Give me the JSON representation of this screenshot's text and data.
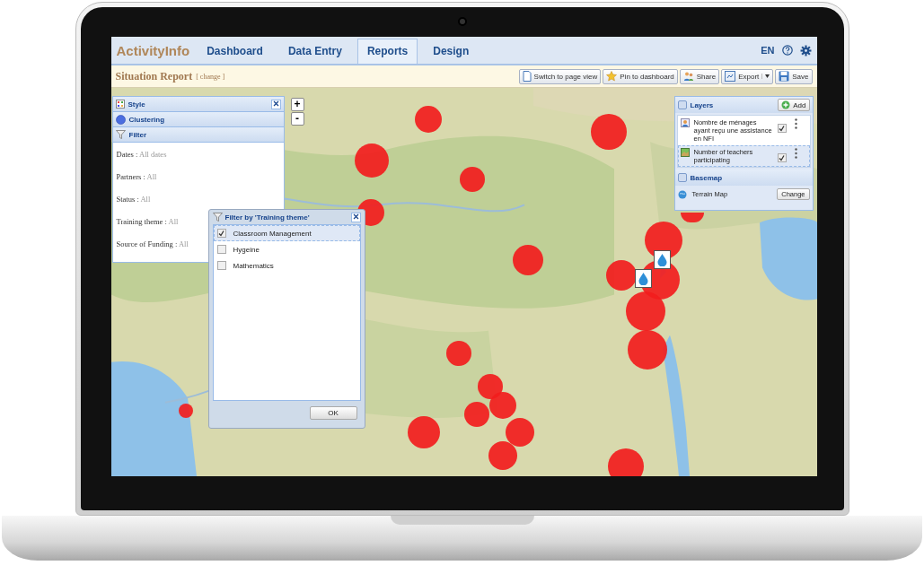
{
  "app": {
    "logo": "ActivityInfo",
    "language": "EN",
    "tabs": [
      {
        "label": "Dashboard",
        "selected": false
      },
      {
        "label": "Data Entry",
        "selected": false
      },
      {
        "label": "Reports",
        "selected": true
      },
      {
        "label": "Design",
        "selected": false
      }
    ]
  },
  "report": {
    "title": "Situation Report",
    "change_link": "[ change ]"
  },
  "toolbar": [
    {
      "label": "Switch to page view",
      "kind": "page"
    },
    {
      "label": "Pin to dashboard",
      "kind": "star"
    },
    {
      "label": "Share",
      "kind": "share"
    },
    {
      "label": "Export",
      "kind": "export",
      "dropdown": true
    },
    {
      "label": "Save",
      "kind": "save"
    }
  ],
  "map": {
    "zoom_in": "+",
    "zoom_out": "-"
  },
  "side_panel": {
    "sections": [
      {
        "title": "Style",
        "kind": "style"
      },
      {
        "title": "Clustering",
        "kind": "clustering"
      },
      {
        "title": "Filter",
        "kind": "filter"
      }
    ],
    "filters": [
      {
        "label": "Dates :",
        "value": "All dates"
      },
      {
        "label": "Partners :",
        "value": "All"
      },
      {
        "label": "Status :",
        "value": "All"
      },
      {
        "label": "Training theme :",
        "value": "All"
      },
      {
        "label": "Source of Funding :",
        "value": "All"
      }
    ]
  },
  "filter_dialog": {
    "title": "Filter by 'Training theme'",
    "ok": "OK",
    "options": [
      {
        "label": "Classroom Management",
        "checked": true,
        "selected": true
      },
      {
        "label": "Hygeine",
        "checked": false,
        "selected": false
      },
      {
        "label": "Mathematics",
        "checked": false,
        "selected": false
      }
    ]
  },
  "layers": {
    "title": "Layers",
    "add": "Add",
    "items": [
      {
        "name": "Nombre de ménages ayant reçu une assistance en NFI",
        "visible": true,
        "selected": false
      },
      {
        "name": "Number of teachers participating",
        "visible": true,
        "selected": true
      }
    ],
    "basemap_title": "Basemap",
    "basemap": "Terrain Map",
    "change": "Change"
  }
}
